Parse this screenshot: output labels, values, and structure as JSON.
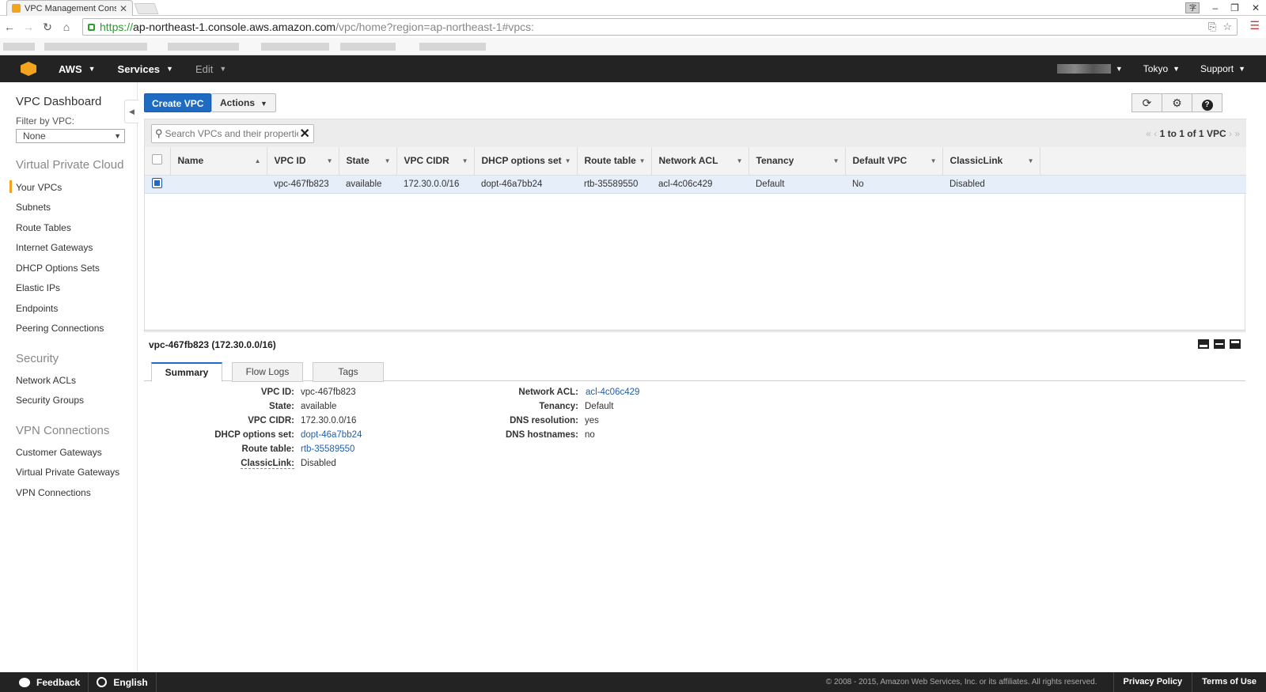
{
  "browser": {
    "tab_title": "VPC Management Cons",
    "url_scheme": "https://",
    "url_host": "ap-northeast-1.console.aws.amazon.com",
    "url_path": "/vpc/home?region=ap-northeast-1#vpcs:"
  },
  "aws_nav": {
    "aws_label": "AWS",
    "services_label": "Services",
    "edit_label": "Edit",
    "region_label": "Tokyo",
    "support_label": "Support"
  },
  "sidebar": {
    "dashboard": "VPC Dashboard",
    "filter_label": "Filter by VPC:",
    "filter_value": "None",
    "sections": [
      {
        "title": "Virtual Private Cloud",
        "items": [
          "Your VPCs",
          "Subnets",
          "Route Tables",
          "Internet Gateways",
          "DHCP Options Sets",
          "Elastic IPs",
          "Endpoints",
          "Peering Connections"
        ]
      },
      {
        "title": "Security",
        "items": [
          "Network ACLs",
          "Security Groups"
        ]
      },
      {
        "title": "VPN Connections",
        "items": [
          "Customer Gateways",
          "Virtual Private Gateways",
          "VPN Connections"
        ]
      }
    ]
  },
  "toolbar": {
    "create_label": "Create VPC",
    "actions_label": "Actions"
  },
  "search": {
    "placeholder": "Search VPCs and their properties",
    "pager": "1 to 1 of 1 VPC"
  },
  "table": {
    "headers": [
      "Name",
      "VPC ID",
      "State",
      "VPC CIDR",
      "DHCP options set",
      "Route table",
      "Network ACL",
      "Tenancy",
      "Default VPC",
      "ClassicLink"
    ],
    "rows": [
      [
        "",
        "vpc-467fb823",
        "available",
        "172.30.0.0/16",
        "dopt-46a7bb24",
        "rtb-35589550",
        "acl-4c06c429",
        "Default",
        "No",
        "Disabled"
      ]
    ]
  },
  "details": {
    "title": "vpc-467fb823 (172.30.0.0/16)",
    "tabs": [
      "Summary",
      "Flow Logs",
      "Tags"
    ],
    "left": [
      {
        "k": "VPC ID:",
        "v": "vpc-467fb823"
      },
      {
        "k": "State:",
        "v": "available"
      },
      {
        "k": "VPC CIDR:",
        "v": "172.30.0.0/16"
      },
      {
        "k": "DHCP options set:",
        "v": "dopt-46a7bb24"
      },
      {
        "k": "Route table:",
        "v": "rtb-35589550"
      },
      {
        "k": "ClassicLink:",
        "v": "Disabled"
      }
    ],
    "right": [
      {
        "k": "Network ACL:",
        "v": "acl-4c06c429"
      },
      {
        "k": "Tenancy:",
        "v": "Default"
      },
      {
        "k": "DNS resolution:",
        "v": "yes"
      },
      {
        "k": "DNS hostnames:",
        "v": "no"
      }
    ]
  },
  "footer": {
    "feedback": "Feedback",
    "language": "English",
    "copyright": "© 2008 - 2015, Amazon Web Services, Inc. or its affiliates. All rights reserved.",
    "privacy": "Privacy Policy",
    "terms": "Terms of Use"
  },
  "colors": {
    "primary": "#1f6bc2",
    "nav_bg": "#232323",
    "accent": "#f3a31c",
    "available": "#2a8a2a"
  }
}
